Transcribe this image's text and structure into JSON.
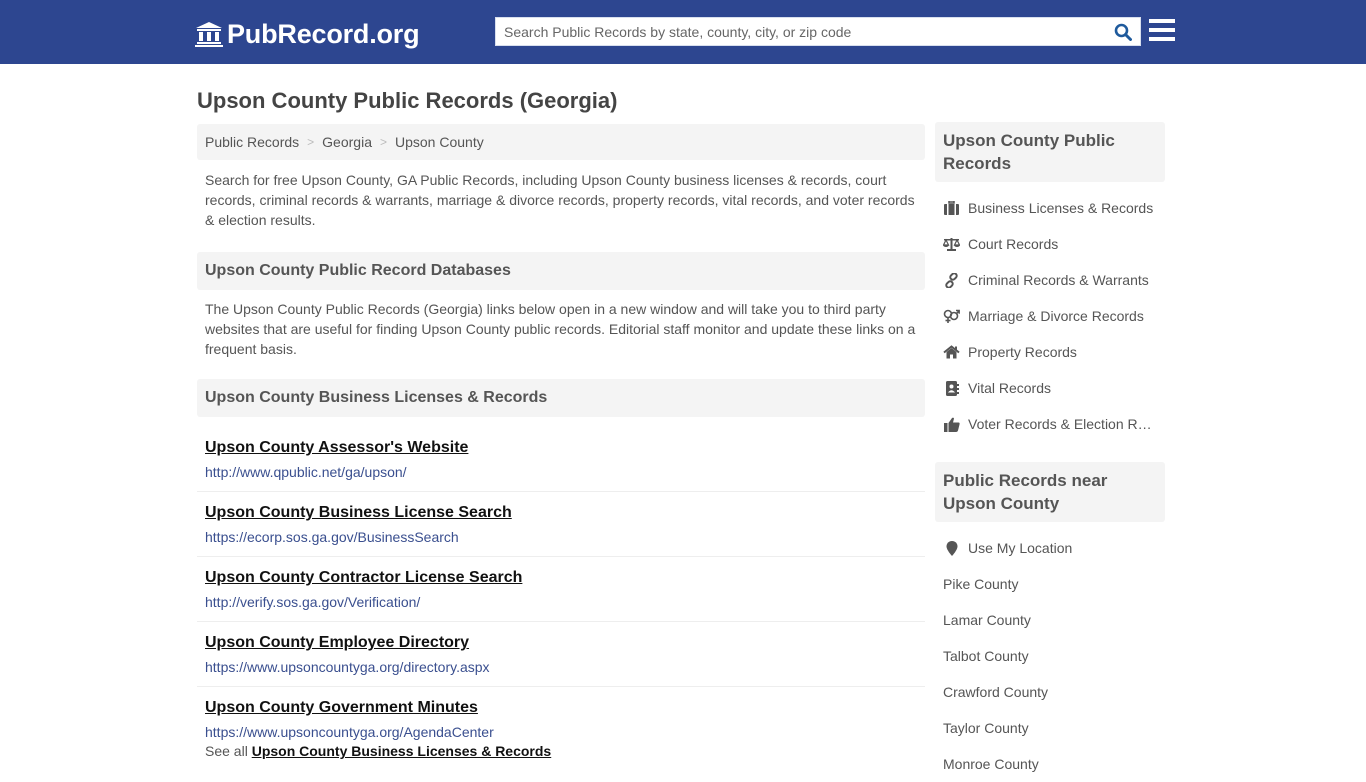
{
  "header": {
    "logo_text": "PubRecord.org",
    "search_placeholder": "Search Public Records by state, county, city, or zip code",
    "search_value": ""
  },
  "page": {
    "title": "Upson County Public Records (Georgia)"
  },
  "breadcrumb": [
    {
      "label": "Public Records"
    },
    {
      "label": "Georgia"
    },
    {
      "label": "Upson County"
    }
  ],
  "breadcrumb_separator": ">",
  "intro": "Search for free Upson County, GA Public Records, including Upson County business licenses & records, court records, criminal records & warrants, marriage & divorce records, property records, vital records, and voter records & election results.",
  "databases": {
    "heading": "Upson County Public Record Databases",
    "description": "The Upson County Public Records (Georgia) links below open in a new window and will take you to third party websites that are useful for finding Upson County public records. Editorial staff monitor and update these links on a frequent basis."
  },
  "business_section": {
    "heading": "Upson County Business Licenses & Records",
    "links": [
      {
        "title": "Upson County Assessor's Website",
        "url": "http://www.qpublic.net/ga/upson/"
      },
      {
        "title": "Upson County Business License Search",
        "url": "https://ecorp.sos.ga.gov/BusinessSearch"
      },
      {
        "title": "Upson County Contractor License Search",
        "url": "http://verify.sos.ga.gov/Verification/"
      },
      {
        "title": "Upson County Employee Directory",
        "url": "https://www.upsoncountyga.org/directory.aspx"
      },
      {
        "title": "Upson County Government Minutes",
        "url": "https://www.upsoncountyga.org/AgendaCenter"
      }
    ],
    "see_all_prefix": "See all",
    "see_all_link": "Upson County Business Licenses & Records"
  },
  "sidebar": {
    "records_heading": "Upson County Public Records",
    "records": [
      {
        "label": "Business Licenses & Records",
        "icon": "briefcase-icon"
      },
      {
        "label": "Court Records",
        "icon": "balance-scale-icon"
      },
      {
        "label": "Criminal Records & Warrants",
        "icon": "link-icon"
      },
      {
        "label": "Marriage & Divorce Records",
        "icon": "venus-mars-icon"
      },
      {
        "label": "Property Records",
        "icon": "home-icon"
      },
      {
        "label": "Vital Records",
        "icon": "address-book-icon"
      },
      {
        "label": "Voter Records & Election Results",
        "icon": "thumbs-up-icon"
      }
    ],
    "near_heading": "Public Records near Upson County",
    "use_location": "Use My Location",
    "nearby": [
      {
        "label": "Pike County"
      },
      {
        "label": "Lamar County"
      },
      {
        "label": "Talbot County"
      },
      {
        "label": "Crawford County"
      },
      {
        "label": "Taylor County"
      },
      {
        "label": "Monroe County"
      }
    ]
  },
  "colors": {
    "header_bg": "#2d4690",
    "search_icon": "#1e5a9c",
    "panel_bg": "#f4f4f4",
    "url_color": "#3a4f8f"
  }
}
